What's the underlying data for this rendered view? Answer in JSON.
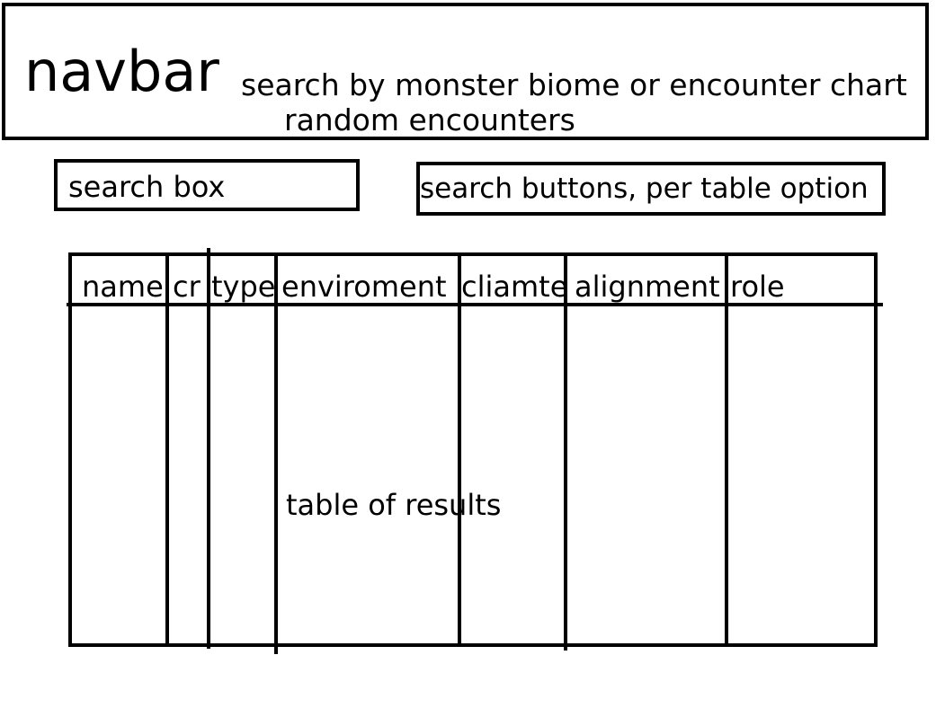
{
  "navbar": {
    "title": "navbar",
    "description_line1": "search by monster biome or encounter chart",
    "description_line2": "random encounters"
  },
  "search": {
    "placeholder": "search box"
  },
  "search_buttons": {
    "label": "search buttons, per table option"
  },
  "table": {
    "columns": [
      "name",
      "cr",
      "type",
      "enviroment",
      "cliamte",
      "alignment",
      "role"
    ],
    "placeholder": "table of results"
  }
}
